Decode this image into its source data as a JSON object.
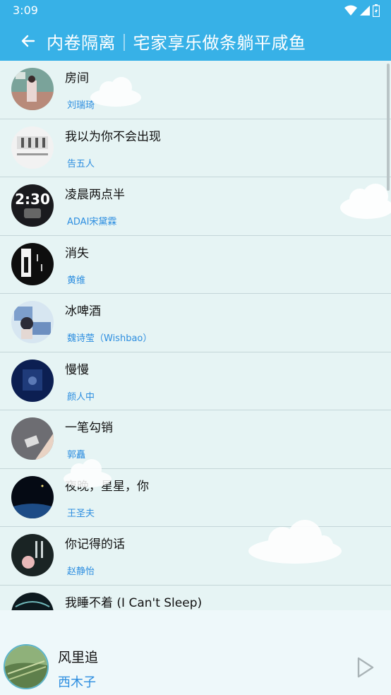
{
  "status": {
    "time": "3:09"
  },
  "header": {
    "title": "内卷隔离｜宅家享乐做条躺平咸鱼"
  },
  "songs": [
    {
      "title": "房间",
      "artist": "刘瑞琦"
    },
    {
      "title": "我以为你不会出现",
      "artist": "告五人"
    },
    {
      "title": "凌晨两点半",
      "artist": "ADAI宋黛霖"
    },
    {
      "title": "消失",
      "artist": "黄维"
    },
    {
      "title": "冰啤酒",
      "artist": "魏诗莹（Wishbao）"
    },
    {
      "title": "慢慢",
      "artist": "颜人中"
    },
    {
      "title": "一笔勾销",
      "artist": "郭矗"
    },
    {
      "title": "夜晚，星星，你",
      "artist": "王圣夫"
    },
    {
      "title": "你记得的话",
      "artist": "赵静怡"
    },
    {
      "title": "我睡不着 (I Can't Sleep)",
      "artist": ""
    }
  ],
  "player": {
    "title": "风里追",
    "artist": "西木子"
  },
  "colors": {
    "accent": "#37b1e7",
    "artist_text": "#2d8ee0",
    "list_bg": "#e6f4f4"
  }
}
